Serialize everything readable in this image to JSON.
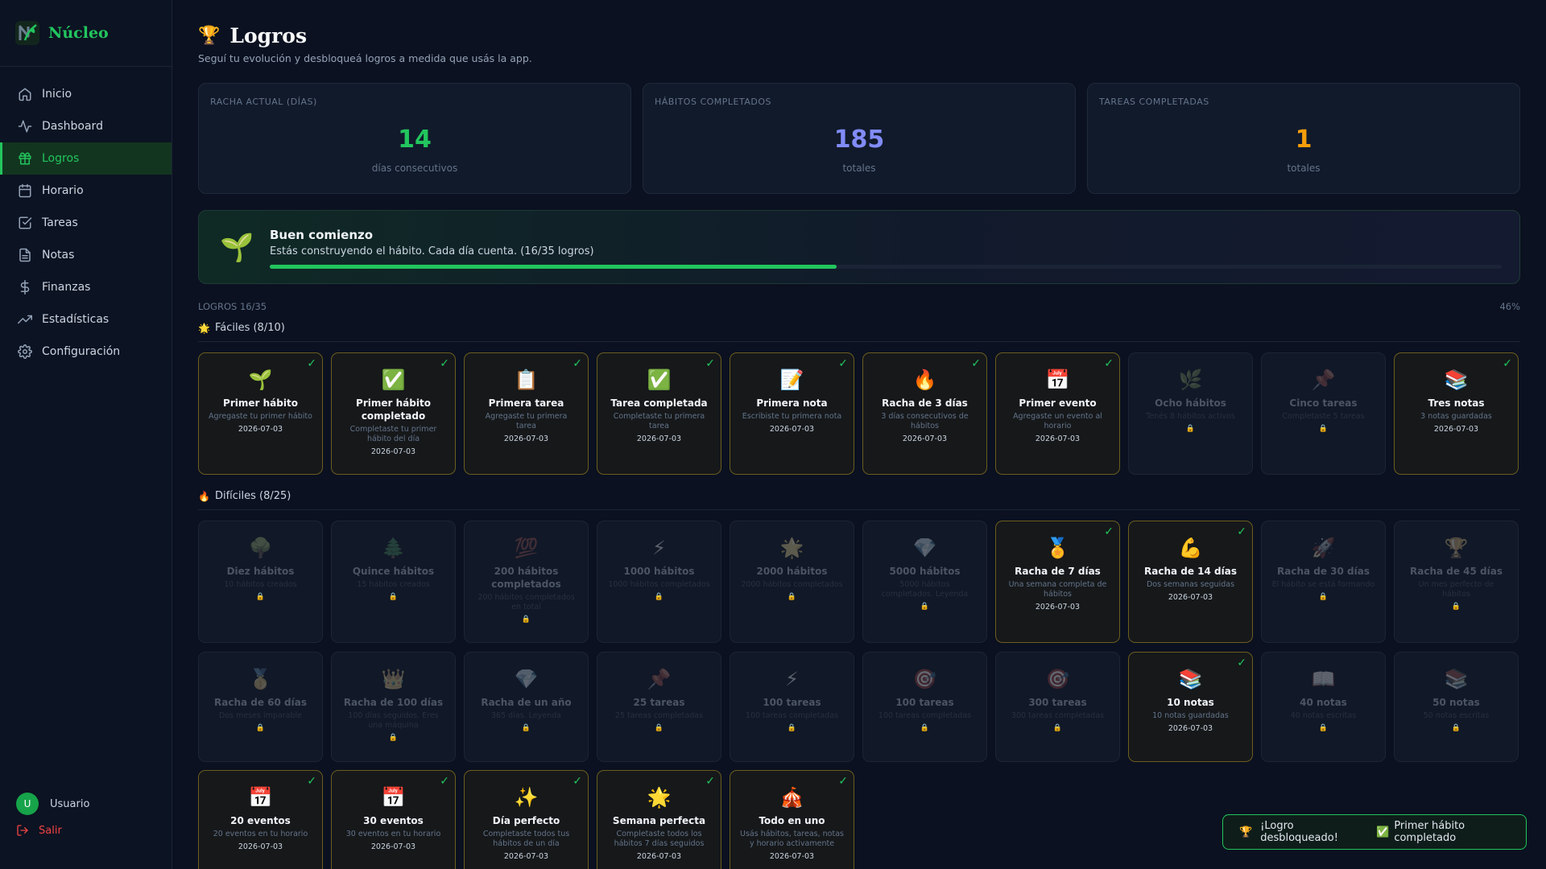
{
  "brand": {
    "name": "Núcleo"
  },
  "nav": [
    {
      "label": "Inicio",
      "icon": "home-icon"
    },
    {
      "label": "Dashboard",
      "icon": "activity-icon"
    },
    {
      "label": "Logros",
      "icon": "gift-icon",
      "active": true
    },
    {
      "label": "Horario",
      "icon": "calendar-icon"
    },
    {
      "label": "Tareas",
      "icon": "checkbox-icon"
    },
    {
      "label": "Notas",
      "icon": "file-icon"
    },
    {
      "label": "Finanzas",
      "icon": "dollar-icon"
    },
    {
      "label": "Estadísticas",
      "icon": "trend-icon"
    },
    {
      "label": "Configuración",
      "icon": "gear-icon"
    }
  ],
  "user": {
    "initial": "U",
    "name": "Usuario",
    "logout": "Salir"
  },
  "page": {
    "icon": "🏆",
    "title": "Logros",
    "subtitle": "Seguí tu evolución y desbloqueá logros a medida que usás la app."
  },
  "stats": [
    {
      "label": "RACHA ACTUAL (DÍAS)",
      "value": "14",
      "sub": "días consecutivos",
      "color": "#22c55e"
    },
    {
      "label": "HÁBITOS COMPLETADOS",
      "value": "185",
      "sub": "totales",
      "color": "#818cf8"
    },
    {
      "label": "TAREAS COMPLETADAS",
      "value": "1",
      "sub": "totales",
      "color": "#f59e0b"
    }
  ],
  "banner": {
    "icon": "🌱",
    "title": "Buen comienzo",
    "text": "Estás construyendo el hábito. Cada día cuenta. (16/35 logros)",
    "progress": 0.46
  },
  "summary": {
    "count": "LOGROS 16/35",
    "percent": "46%"
  },
  "sections": [
    {
      "icon": "🌟",
      "title": "Fáciles (8/10)"
    },
    {
      "icon": "🔥",
      "title": "Difíciles (8/25)"
    }
  ],
  "easy": [
    {
      "icon": "🌱",
      "title": "Primer hábito",
      "desc": "Agregaste tu primer hábito",
      "date": "2026-07-03",
      "unlocked": true
    },
    {
      "icon": "✅",
      "title": "Primer hábito completado",
      "desc": "Completaste tu primer hábito del día",
      "date": "2026-07-03",
      "unlocked": true
    },
    {
      "icon": "📋",
      "title": "Primera tarea",
      "desc": "Agregaste tu primera tarea",
      "date": "2026-07-03",
      "unlocked": true
    },
    {
      "icon": "✅",
      "title": "Tarea completada",
      "desc": "Completaste tu primera tarea",
      "date": "2026-07-03",
      "unlocked": true
    },
    {
      "icon": "📝",
      "title": "Primera nota",
      "desc": "Escribiste tu primera nota",
      "date": "2026-07-03",
      "unlocked": true
    },
    {
      "icon": "🔥",
      "title": "Racha de 3 días",
      "desc": "3 días consecutivos de hábitos",
      "date": "2026-07-03",
      "unlocked": true
    },
    {
      "icon": "📅",
      "title": "Primer evento",
      "desc": "Agregaste un evento al horario",
      "date": "2026-07-03",
      "unlocked": true
    },
    {
      "icon": "🌿",
      "title": "Ocho hábitos",
      "desc": "Tenés 8 hábitos activos",
      "date": "",
      "unlocked": false
    },
    {
      "icon": "📌",
      "title": "Cinco tareas",
      "desc": "Completaste 5 tareas",
      "date": "",
      "unlocked": false
    },
    {
      "icon": "📚",
      "title": "Tres notas",
      "desc": "3 notas guardadas",
      "date": "2026-07-03",
      "unlocked": true
    }
  ],
  "hard_row1": [
    {
      "icon": "🌳",
      "title": "Diez hábitos",
      "desc": "10 hábitos creados",
      "date": "",
      "unlocked": false
    },
    {
      "icon": "🌲",
      "title": "Quince hábitos",
      "desc": "15 hábitos creados",
      "date": "",
      "unlocked": false
    },
    {
      "icon": "💯",
      "title": "200 hábitos completados",
      "desc": "200 hábitos completados en total",
      "date": "",
      "unlocked": false
    },
    {
      "icon": "⚡",
      "title": "1000 hábitos",
      "desc": "1000 hábitos completados",
      "date": "",
      "unlocked": false
    },
    {
      "icon": "🌟",
      "title": "2000 hábitos",
      "desc": "2000 hábitos completados",
      "date": "",
      "unlocked": false
    },
    {
      "icon": "💎",
      "title": "5000 hábitos",
      "desc": "5000 hábitos completados. Leyenda",
      "date": "",
      "unlocked": false
    },
    {
      "icon": "🏅",
      "title": "Racha de 7 días",
      "desc": "Una semana completa de hábitos",
      "date": "2026-07-03",
      "unlocked": true
    },
    {
      "icon": "💪",
      "title": "Racha de 14 días",
      "desc": "Dos semanas seguidas",
      "date": "2026-07-03",
      "unlocked": true
    },
    {
      "icon": "🚀",
      "title": "Racha de 30 días",
      "desc": "El hábito se está formando",
      "date": "",
      "unlocked": false
    },
    {
      "icon": "🏆",
      "title": "Racha de 45 días",
      "desc": "Un mes perfecto de hábitos",
      "date": "",
      "unlocked": false
    }
  ],
  "hard_row2": [
    {
      "icon": "🥇",
      "title": "Racha de 60 días",
      "desc": "Dos meses imparable",
      "date": "",
      "unlocked": false
    },
    {
      "icon": "👑",
      "title": "Racha de 100 días",
      "desc": "100 días seguidos. Eres una máquina",
      "date": "",
      "unlocked": false
    },
    {
      "icon": "💎",
      "title": "Racha de un año",
      "desc": "365 días. Leyenda",
      "date": "",
      "unlocked": false
    },
    {
      "icon": "📌",
      "title": "25 tareas",
      "desc": "25 tareas completadas",
      "date": "",
      "unlocked": false
    },
    {
      "icon": "⚡",
      "title": "100 tareas",
      "desc": "100 tareas completadas",
      "date": "",
      "unlocked": false
    },
    {
      "icon": "🎯",
      "title": "100 tareas",
      "desc": "100 tareas completadas",
      "date": "",
      "unlocked": false
    },
    {
      "icon": "🎯",
      "title": "300 tareas",
      "desc": "300 tareas completadas",
      "date": "",
      "unlocked": false
    },
    {
      "icon": "📚",
      "title": "10 notas",
      "desc": "10 notas guardadas",
      "date": "2026-07-03",
      "unlocked": true
    },
    {
      "icon": "📖",
      "title": "40 notas",
      "desc": "40 notas escritas",
      "date": "",
      "unlocked": false
    },
    {
      "icon": "📚",
      "title": "50 notas",
      "desc": "50 notas escritas",
      "date": "",
      "unlocked": false
    }
  ],
  "hard_row3": [
    {
      "icon": "📅",
      "title": "20 eventos",
      "desc": "20 eventos en tu horario",
      "date": "2026-07-03",
      "unlocked": true
    },
    {
      "icon": "📅",
      "title": "30 eventos",
      "desc": "30 eventos en tu horario",
      "date": "2026-07-03",
      "unlocked": true
    },
    {
      "icon": "✨",
      "title": "Día perfecto",
      "desc": "Completaste todos tus hábitos de un día",
      "date": "2026-07-03",
      "unlocked": true
    },
    {
      "icon": "🌟",
      "title": "Semana perfecta",
      "desc": "Completaste todos los hábitos 7 días seguidos",
      "date": "2026-07-03",
      "unlocked": true
    },
    {
      "icon": "🎪",
      "title": "Todo en uno",
      "desc": "Usás hábitos, tareas, notas y horario activamente",
      "date": "2026-07-03",
      "unlocked": true
    }
  ],
  "toast": {
    "icon": "🏆",
    "text": "¡Logro desbloqueado!",
    "badge": "✅",
    "name": "Primer hábito completado"
  }
}
